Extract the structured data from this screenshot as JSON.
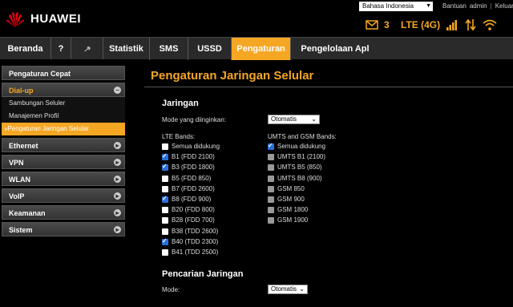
{
  "header": {
    "brand": "HUAWEI",
    "language": "Bahasa Indonesia",
    "links": [
      "Bantuan",
      "admin",
      "Keluar"
    ],
    "message_count": "3",
    "network_type": "LTE (4G)",
    "accent": "#f5a623"
  },
  "nav": {
    "items": [
      "Beranda",
      "?",
      "",
      "Statistik",
      "SMS",
      "USSD",
      "Pengaturan",
      "Pengelolaan Apl"
    ],
    "active": "Pengaturan"
  },
  "sidebar": {
    "quick": "Pengaturan Cepat",
    "dialup": "Dial-up",
    "sub": [
      "Sambungan Seluler",
      "Manajemen Profil",
      "Pengaturan Jaringan Selular"
    ],
    "active_sub_prefix": "»",
    "groups": [
      "Ethernet",
      "VPN",
      "WLAN",
      "VoIP",
      "Keamanan",
      "Sistem"
    ]
  },
  "main": {
    "title": "Pengaturan Jaringan Selular",
    "network": {
      "heading": "Jaringan",
      "mode_label": "Mode yang diinginkan:",
      "mode_value": "Otomatis",
      "lte_label": "LTE Bands:",
      "umts_label": "UMTS and GSM Bands:",
      "lte_bands": [
        {
          "label": "Semua didukung",
          "checked": false
        },
        {
          "label": "B1 (FDD 2100)",
          "checked": true
        },
        {
          "label": "B3 (FDD 1800)",
          "checked": true
        },
        {
          "label": "B5 (FDD 850)",
          "checked": false
        },
        {
          "label": "B7 (FDD 2600)",
          "checked": false
        },
        {
          "label": "B8 (FDD 900)",
          "checked": true
        },
        {
          "label": "B20 (FDD 800)",
          "checked": false
        },
        {
          "label": "B28 (FDD 700)",
          "checked": false
        },
        {
          "label": "B38 (TDD 2600)",
          "checked": false
        },
        {
          "label": "B40 (TDD 2300)",
          "checked": true
        },
        {
          "label": "B41 (TDD 2500)",
          "checked": false
        }
      ],
      "umts_bands": [
        {
          "label": "Semua didukung",
          "checked": true,
          "disabled": false
        },
        {
          "label": "UMTS B1 (2100)",
          "checked": false,
          "disabled": true
        },
        {
          "label": "UMTS B5 (850)",
          "checked": false,
          "disabled": true
        },
        {
          "label": "UMTS B8 (900)",
          "checked": false,
          "disabled": true
        },
        {
          "label": "GSM 850",
          "checked": false,
          "disabled": true
        },
        {
          "label": "GSM 900",
          "checked": false,
          "disabled": true
        },
        {
          "label": "GSM 1800",
          "checked": false,
          "disabled": true
        },
        {
          "label": "GSM 1900",
          "checked": false,
          "disabled": true
        }
      ]
    },
    "search": {
      "heading": "Pencarian Jaringan",
      "mode_label": "Mode:",
      "mode_value": "Otomatis"
    }
  }
}
